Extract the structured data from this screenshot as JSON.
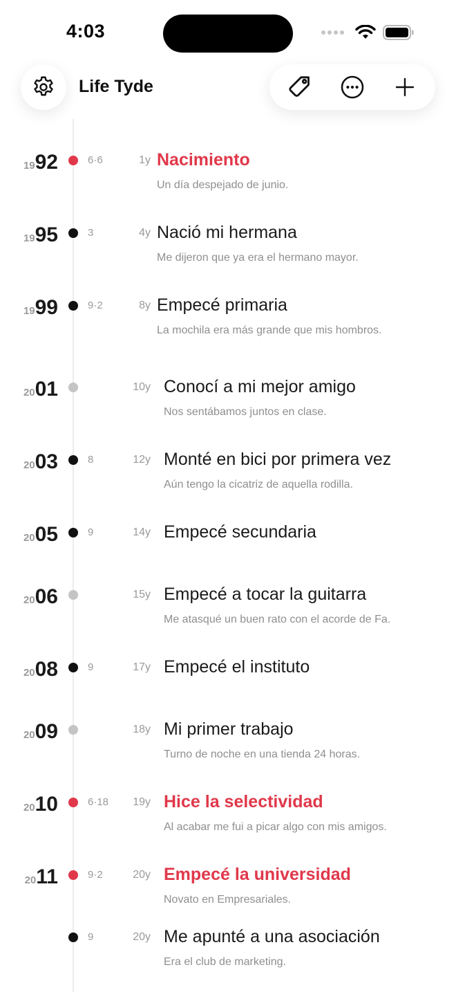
{
  "status_bar": {
    "time": "4:03"
  },
  "header": {
    "title": "Life Tyde"
  },
  "icons": {
    "settings": "gear-icon",
    "tag": "tag-icon",
    "more": "more-horizontal-icon",
    "add": "plus-icon"
  },
  "colors": {
    "accent": "#e0384a",
    "muted": "#9a9a9a",
    "grey_dot": "#c4c4c4"
  },
  "events": [
    {
      "year_prefix": "19",
      "year_suffix": "92",
      "date": "6·6",
      "age": "1y",
      "title": "Nacimiento",
      "desc": "Un día despejado de junio.",
      "highlight": true,
      "dot": "red"
    },
    {
      "year_prefix": "19",
      "year_suffix": "95",
      "date": "3",
      "age": "4y",
      "title": "Nació mi hermana",
      "desc": "Me dijeron que ya era el hermano mayor.",
      "highlight": false,
      "dot": "black"
    },
    {
      "year_prefix": "19",
      "year_suffix": "99",
      "date": "9·2",
      "age": "8y",
      "title": "Empecé primaria",
      "desc": "La mochila era más grande que mis hombros.",
      "highlight": false,
      "dot": "black"
    },
    {
      "year_prefix": "20",
      "year_suffix": "01",
      "date": "",
      "age": "10y",
      "title": "Conocí a mi mejor amigo",
      "desc": "Nos sentábamos juntos en clase.",
      "highlight": false,
      "dot": "grey"
    },
    {
      "year_prefix": "20",
      "year_suffix": "03",
      "date": "8",
      "age": "12y",
      "title": "Monté en bici por primera vez",
      "desc": "Aún tengo la cicatriz de aquella rodilla.",
      "highlight": false,
      "dot": "black"
    },
    {
      "year_prefix": "20",
      "year_suffix": "05",
      "date": "9",
      "age": "14y",
      "title": "Empecé secundaria",
      "desc": "",
      "highlight": false,
      "dot": "black"
    },
    {
      "year_prefix": "20",
      "year_suffix": "06",
      "date": "",
      "age": "15y",
      "title": "Empecé a tocar la guitarra",
      "desc": "Me atasqué un buen rato con el acorde de Fa.",
      "highlight": false,
      "dot": "grey"
    },
    {
      "year_prefix": "20",
      "year_suffix": "08",
      "date": "9",
      "age": "17y",
      "title": "Empecé el instituto",
      "desc": "",
      "highlight": false,
      "dot": "black"
    },
    {
      "year_prefix": "20",
      "year_suffix": "09",
      "date": "",
      "age": "18y",
      "title": "Mi primer trabajo",
      "desc": "Turno de noche en una tienda 24 horas.",
      "highlight": false,
      "dot": "grey"
    },
    {
      "year_prefix": "20",
      "year_suffix": "10",
      "date": "6·18",
      "age": "19y",
      "title": "Hice la selectividad",
      "desc": "Al acabar me fui a picar algo con mis amigos.",
      "highlight": true,
      "dot": "red"
    },
    {
      "year_prefix": "20",
      "year_suffix": "11",
      "date": "9·2",
      "age": "20y",
      "title": "Empecé la universidad",
      "desc": "Novato en Empresariales.",
      "highlight": true,
      "dot": "red"
    },
    {
      "year_prefix": "",
      "year_suffix": "",
      "date": "9",
      "age": "20y",
      "title": "Me apunté a una asociación",
      "desc": "Era el club de marketing.",
      "highlight": false,
      "dot": "black"
    }
  ]
}
